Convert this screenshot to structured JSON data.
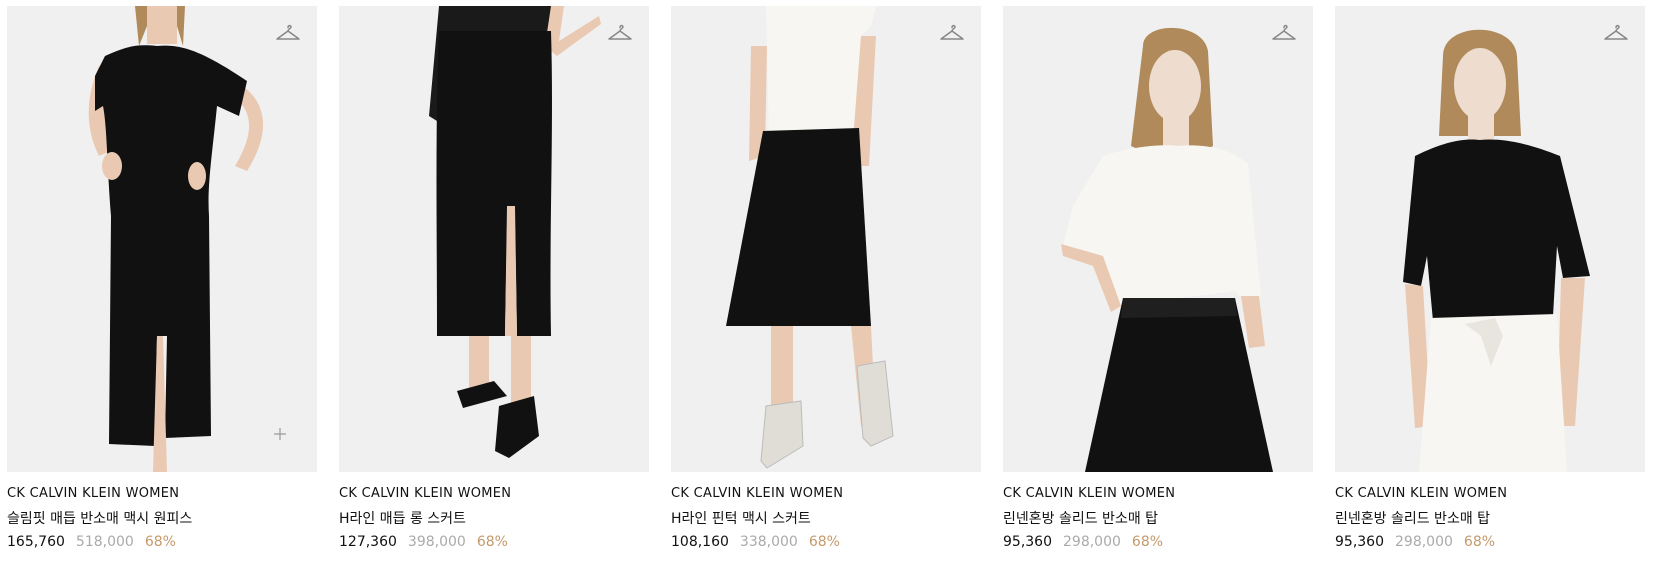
{
  "colors": {
    "image_bg": "#f0f0f0",
    "original_price": "#aaaaaa",
    "discount": "#c49a6c",
    "text": "#111111"
  },
  "products": [
    {
      "brand": "CK CALVIN KLEIN WOMEN",
      "name": "슬림핏 매듭 반소매 맥시 원피스",
      "sale_price": "165,760",
      "original_price": "518,000",
      "discount": "68%",
      "wishlist_icon": "hanger-icon",
      "extra_icon": "plus-icon"
    },
    {
      "brand": "CK CALVIN KLEIN WOMEN",
      "name": "H라인 매듭 롱 스커트",
      "sale_price": "127,360",
      "original_price": "398,000",
      "discount": "68%",
      "wishlist_icon": "hanger-icon"
    },
    {
      "brand": "CK CALVIN KLEIN WOMEN",
      "name": "H라인 핀턱 맥시 스커트",
      "sale_price": "108,160",
      "original_price": "338,000",
      "discount": "68%",
      "wishlist_icon": "hanger-icon"
    },
    {
      "brand": "CK CALVIN KLEIN WOMEN",
      "name": "린넨혼방 솔리드 반소매 탑",
      "sale_price": "95,360",
      "original_price": "298,000",
      "discount": "68%",
      "wishlist_icon": "hanger-icon"
    },
    {
      "brand": "CK CALVIN KLEIN WOMEN",
      "name": "린넨혼방 솔리드 반소매 탑",
      "sale_price": "95,360",
      "original_price": "298,000",
      "discount": "68%",
      "wishlist_icon": "hanger-icon"
    }
  ]
}
